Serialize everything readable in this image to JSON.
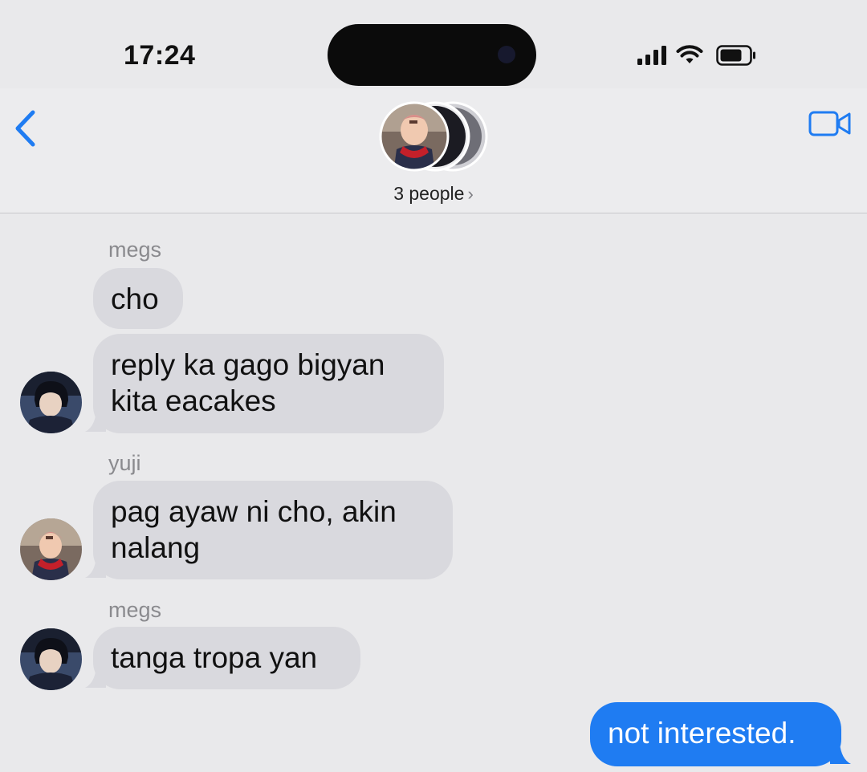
{
  "status_bar": {
    "time": "17:24",
    "icons": [
      "cellular-signal-icon",
      "wifi-icon",
      "battery-icon"
    ]
  },
  "header": {
    "back_icon": "chevron-left-icon",
    "video_icon": "facetime-video-icon",
    "group_label": "3 people",
    "group_chevron": "›"
  },
  "messages": [
    {
      "sender": "megs",
      "text": "cho",
      "direction": "incoming"
    },
    {
      "sender": "megs",
      "text": "reply ka gago bigyan\nkita eacakes",
      "direction": "incoming"
    },
    {
      "sender": "yuji",
      "text": "pag ayaw ni cho, akin\nnalang",
      "direction": "incoming"
    },
    {
      "sender": "megs",
      "text": "tanga tropa yan",
      "direction": "incoming"
    },
    {
      "sender": "",
      "text": "not interested.",
      "direction": "outgoing"
    }
  ],
  "colors": {
    "background": "#e9e9eb",
    "incoming_bubble": "#d9d9de",
    "outgoing_bubble": "#1f7cf2",
    "accent": "#1f7cf2"
  }
}
